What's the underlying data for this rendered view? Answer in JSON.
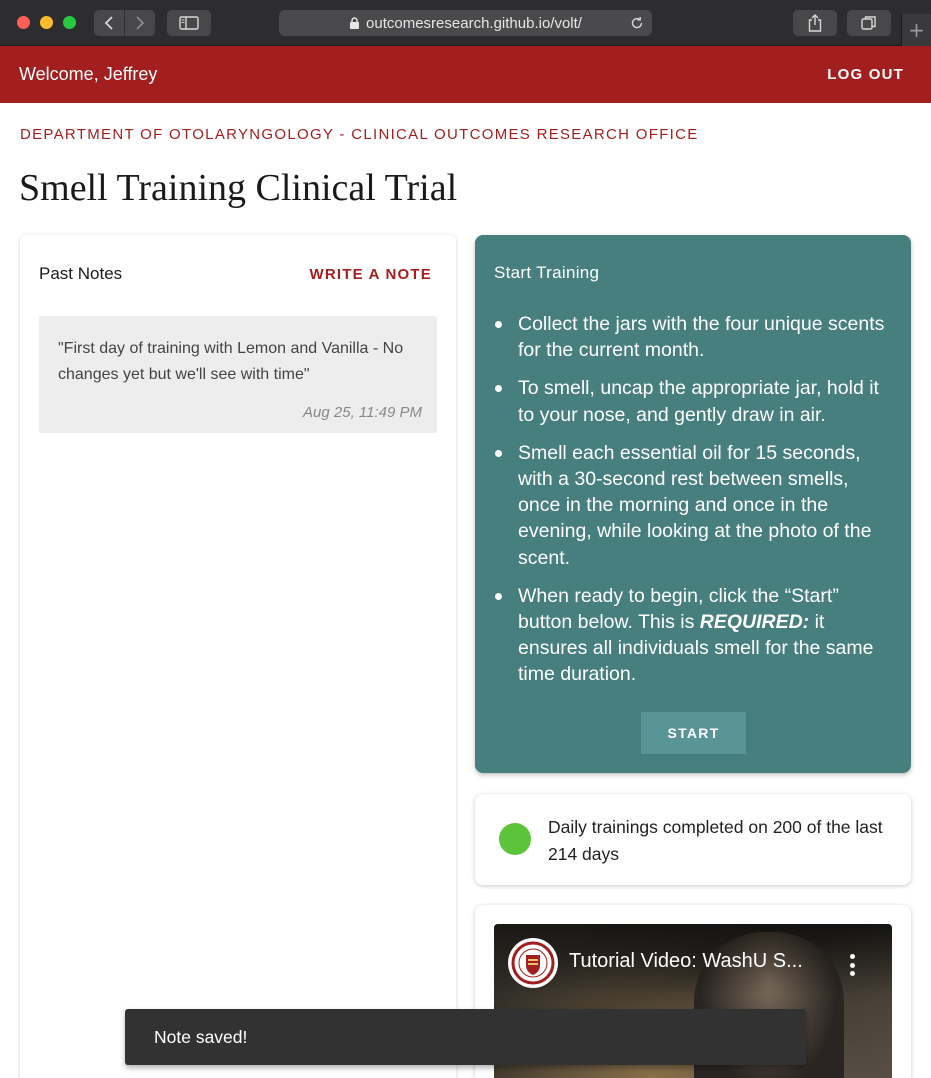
{
  "browser": {
    "url": "outcomesresearch.github.io/volt/",
    "new_tab": "+"
  },
  "header": {
    "welcome": "Welcome, Jeffrey",
    "logout_label": "LOG OUT"
  },
  "page": {
    "department": "DEPARTMENT OF OTOLARYNGOLOGY - CLINICAL OUTCOMES RESEARCH OFFICE",
    "title": "Smell Training Clinical Trial"
  },
  "notes": {
    "title": "Past Notes",
    "write_label": "WRITE A NOTE",
    "items": [
      {
        "text": "\"First day of training with Lemon and Vanilla - No changes yet but we'll see with time\"",
        "time": "Aug 25, 11:49 PM"
      }
    ]
  },
  "training": {
    "title": "Start Training",
    "steps": [
      "Collect the jars with the four unique scents for the current month.",
      "To smell, uncap the appropriate jar, hold it to your nose, and gently draw in air.",
      "Smell each essential oil for 15 seconds, with a 30-second rest between smells, once in the morning and once in the evening, while looking at the photo of the scent."
    ],
    "step4_before": "When ready to begin, click the “Start” button below. This is ",
    "step4_required": "REQUIRED:",
    "step4_after": " it ensures all individuals smell for the same time duration.",
    "start_label": "START"
  },
  "progress": {
    "text": "Daily trainings completed on 200 of the last 214 days",
    "status_color": "#5bc43a"
  },
  "video": {
    "title": "Tutorial Video: WashU S..."
  },
  "snackbar": {
    "message": "Note saved!"
  },
  "colors": {
    "brand_red": "#a31f1f",
    "teal": "#477e7e",
    "teal_button": "#5a9595"
  }
}
